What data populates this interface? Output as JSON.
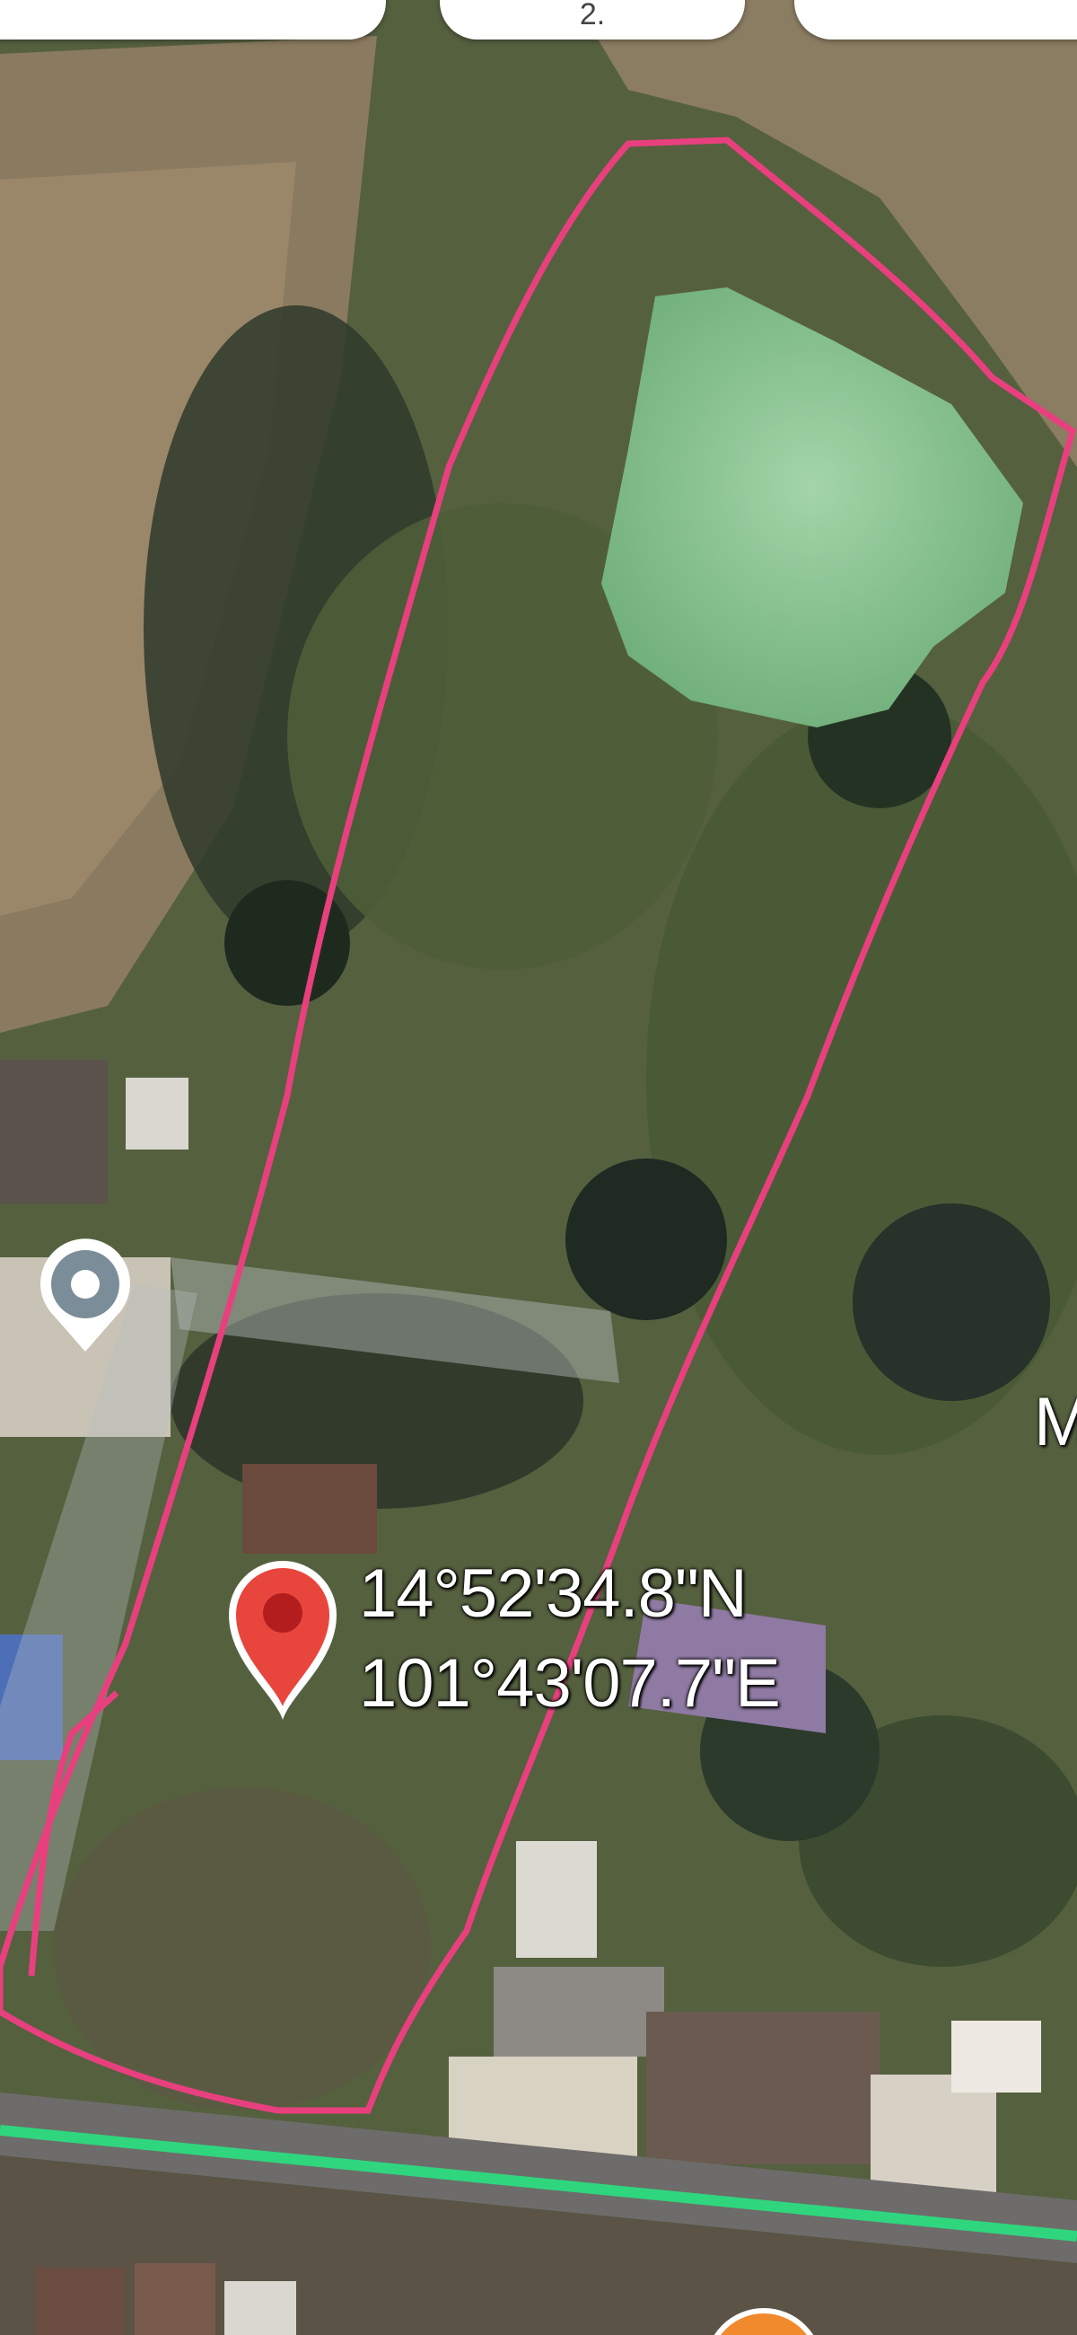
{
  "map": {
    "type": "satellite",
    "colors": {
      "boundary_outline": "#e8407e",
      "route_line": "#2fd67e",
      "pin": "#e8453c",
      "pin_center": "#b31d1d",
      "location_dot": "#7b8d99",
      "orange_marker": "#f08a2c",
      "pond_water": "#8fc79a"
    }
  },
  "pin": {
    "icon": "map-pin-icon",
    "latitude": "14°52'34.8\"N",
    "longitude": "101°43'07.7\"E"
  },
  "edge_label": "M",
  "top_chips": [
    {
      "label": ""
    },
    {
      "label": "2."
    },
    {
      "label": ""
    }
  ],
  "markers": {
    "location": "location-dot-icon",
    "orange": "orange-marker-icon"
  }
}
